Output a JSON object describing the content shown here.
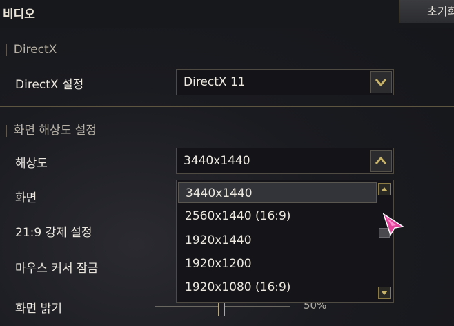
{
  "header": {
    "title": "비디오",
    "reset_label": "초기화"
  },
  "sections": [
    {
      "label": "DirectX"
    },
    {
      "label": "화면 해상도 설정"
    }
  ],
  "directx": {
    "label": "DirectX 설정",
    "value": "DirectX 11"
  },
  "resolution": {
    "label": "해상도",
    "value": "3440x1440",
    "options": [
      "3440x1440",
      "2560x1440 (16:9)",
      "1920x1440",
      "1920x1200",
      "1920x1080 (16:9)"
    ],
    "selected_index": 0
  },
  "rows": {
    "screen_mode": "화면",
    "force_219": "21:9 강제 설정",
    "mouse_lock": "마우스 커서 잠금",
    "brightness": "화면 밝기"
  },
  "brightness": {
    "value_label": "50%",
    "value": 0.5
  },
  "colors": {
    "accent": "#c8b36a",
    "divider": "#5e5540",
    "selected_row": "#33343a"
  }
}
